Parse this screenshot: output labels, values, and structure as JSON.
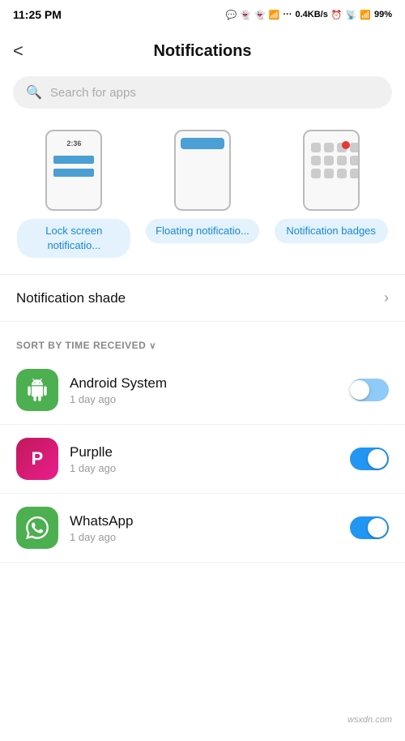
{
  "statusBar": {
    "time": "11:25 PM",
    "network": "0.4KB/s",
    "battery": "99%"
  },
  "header": {
    "back_label": "<",
    "title": "Notifications"
  },
  "search": {
    "placeholder": "Search for apps"
  },
  "notifTypes": [
    {
      "id": "lock-screen",
      "label": "Lock screen notificatio...",
      "type": "lock"
    },
    {
      "id": "floating",
      "label": "Floating notificatio...",
      "type": "float"
    },
    {
      "id": "badges",
      "label": "Notification badges",
      "type": "badge"
    }
  ],
  "shadeRow": {
    "label": "Notification shade"
  },
  "sortSection": {
    "label": "SORT BY TIME RECEIVED"
  },
  "appList": [
    {
      "name": "Android System",
      "time": "1 day ago",
      "icon": "android",
      "enabled": true,
      "lightToggle": true
    },
    {
      "name": "Purplle",
      "time": "1 day ago",
      "icon": "purplle",
      "enabled": true,
      "lightToggle": false
    },
    {
      "name": "WhatsApp",
      "time": "1 day ago",
      "icon": "whatsapp",
      "enabled": true,
      "lightToggle": false
    }
  ],
  "watermark": "wsxdn.com"
}
